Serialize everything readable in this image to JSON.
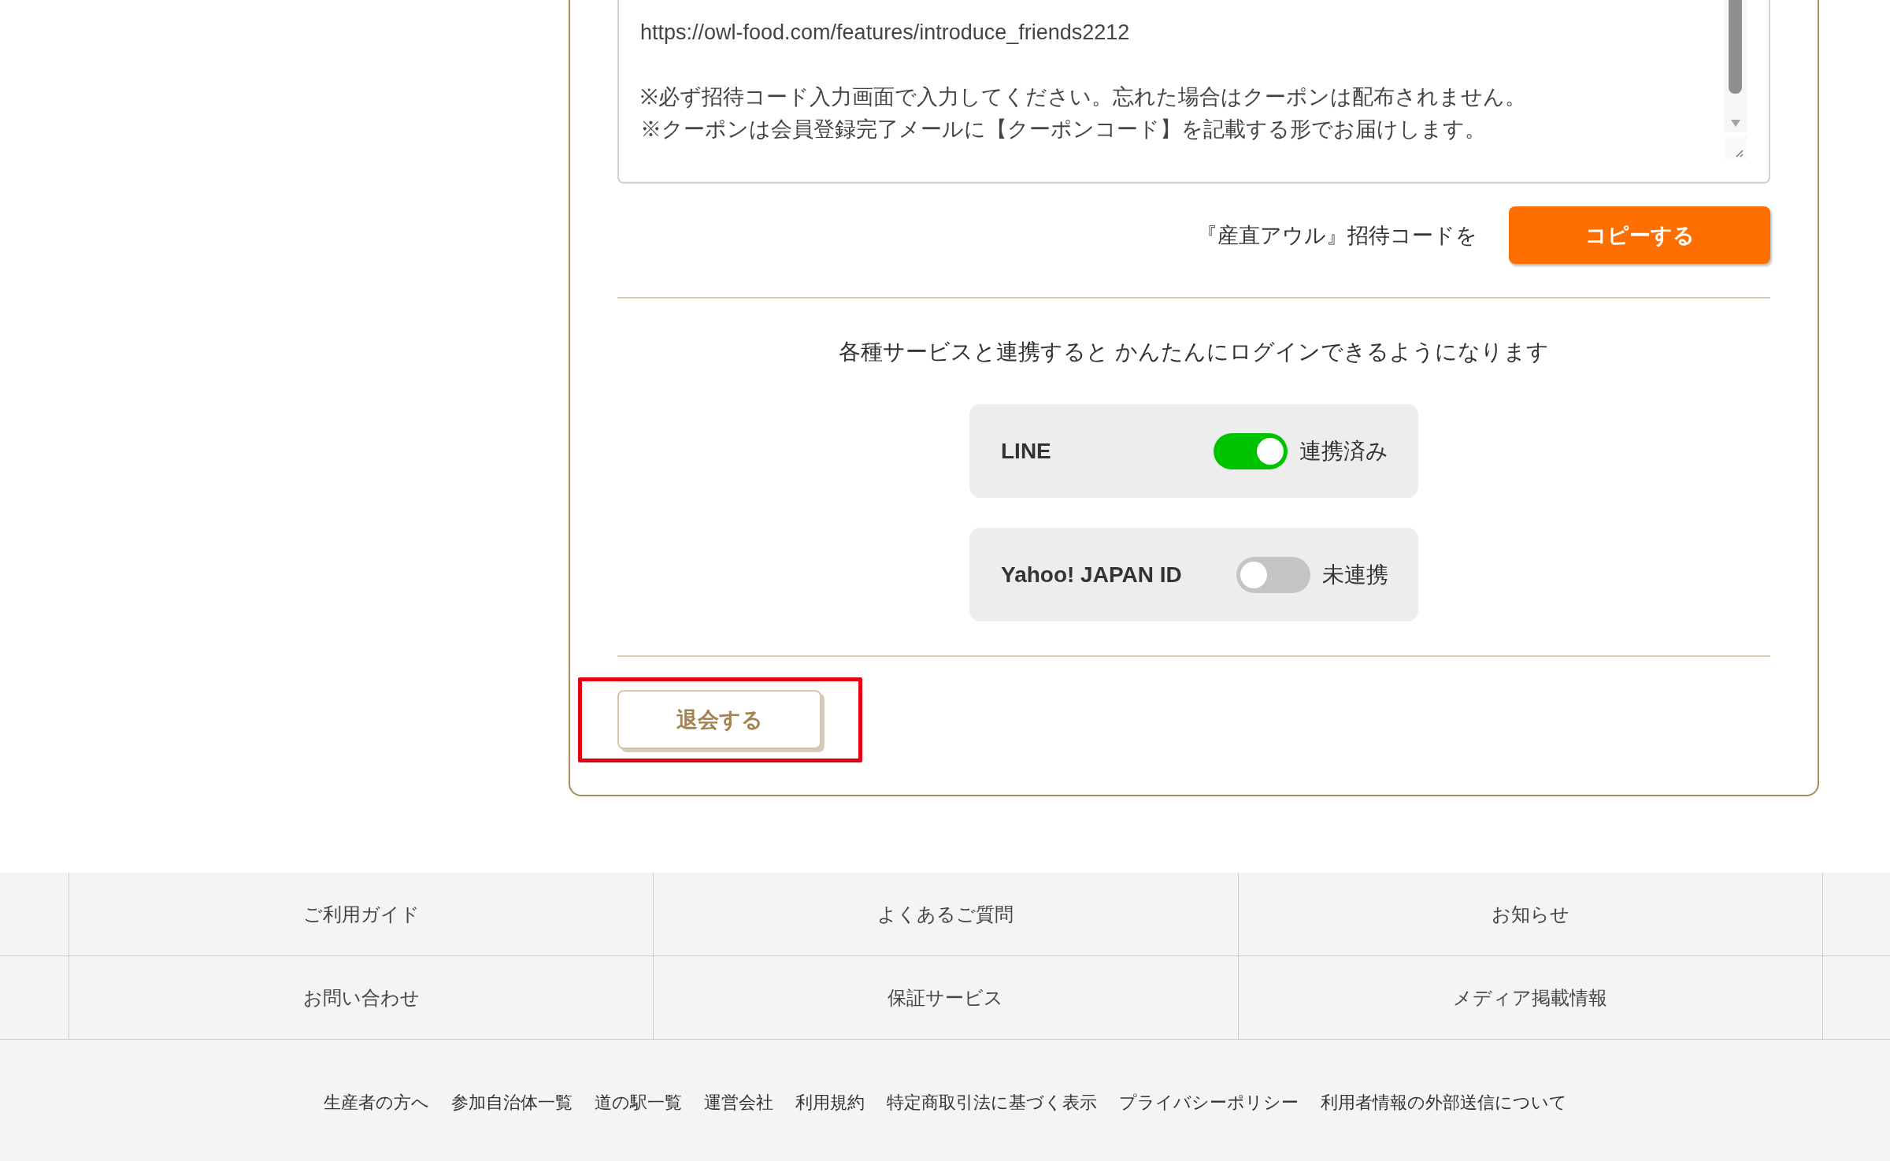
{
  "invite": {
    "message": {
      "value": "https://owl-food.com/features/introduce_friends2212\n\n※必ず招待コード入力画面で入力してください。忘れた場合はクーポンは配布されません。\n※クーポンは会員登録完了メールに【クーポンコード】を記載する形でお届けします。"
    },
    "copy_label": "『産直アウル』招待コードを",
    "copy_button": "コピーする"
  },
  "services": {
    "intro": "各種サービスと連携すると かんたんにログインできるようになります",
    "items": [
      {
        "name": "LINE",
        "on": true,
        "status": "連携済み"
      },
      {
        "name": "Yahoo! JAPAN ID",
        "on": false,
        "status": "未連携"
      }
    ]
  },
  "withdraw_button": {
    "label": "退会する",
    "highlighted": true
  },
  "footer": {
    "nav": [
      "ご利用ガイド",
      "よくあるご質問",
      "お知らせ",
      "お問い合わせ",
      "保証サービス",
      "メディア掲載情報"
    ],
    "links": [
      "生産者の方へ",
      "参加自治体一覧",
      "道の駅一覧",
      "運営会社",
      "利用規約",
      "特定商取引法に基づく表示",
      "プライバシーポリシー",
      "利用者情報の外部送信について"
    ]
  }
}
